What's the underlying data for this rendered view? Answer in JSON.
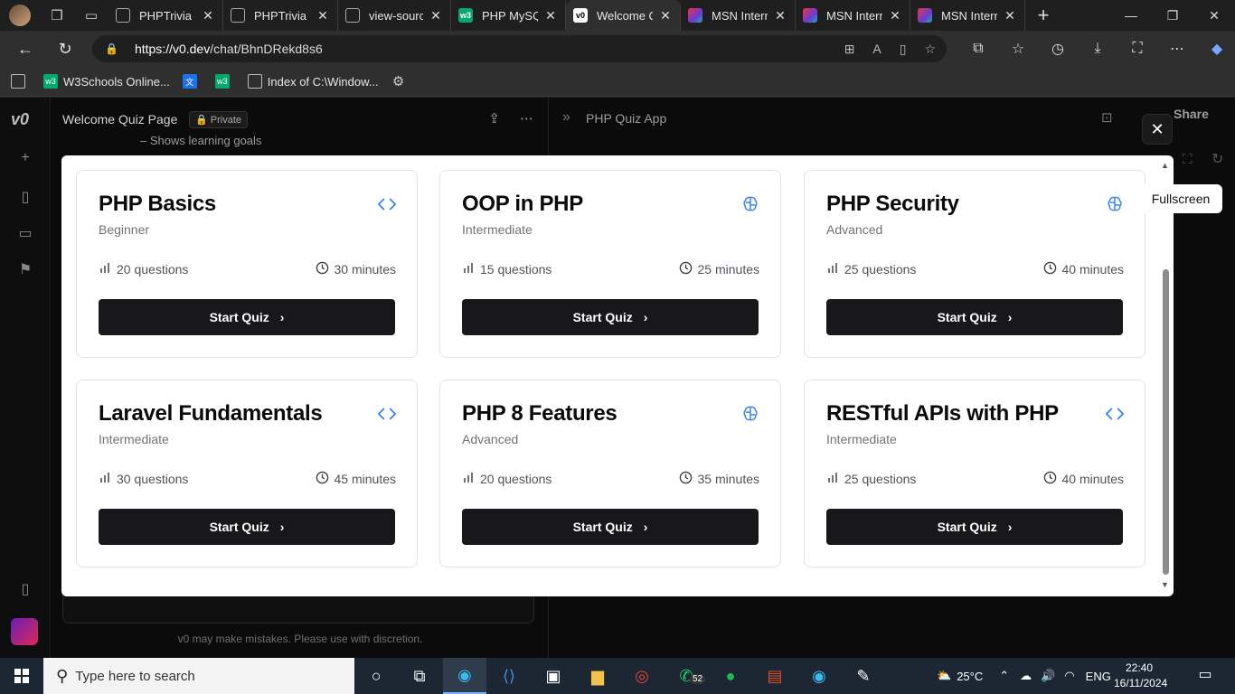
{
  "browser": {
    "tabs": [
      {
        "title": "PHPTrivia - D",
        "icon": "document-icon",
        "color": "#444444",
        "active": false
      },
      {
        "title": "PHPTrivia - D",
        "icon": "document-icon",
        "color": "#444444",
        "active": false
      },
      {
        "title": "view-source:",
        "icon": "document-icon",
        "color": "#444444",
        "active": false
      },
      {
        "title": "PHP MySQL",
        "icon": "w3schools-icon",
        "color": "#04aa6d",
        "active": false
      },
      {
        "title": "Welcome Qu",
        "icon": "v0-icon",
        "color": "#000000",
        "active": true
      },
      {
        "title": "MSN Interna",
        "icon": "msn-icon",
        "color": "#6a3bd6",
        "active": false
      },
      {
        "title": "MSN Interna",
        "icon": "msn-icon",
        "color": "#6a3bd6",
        "active": false
      },
      {
        "title": "MSN Interna",
        "icon": "msn-icon",
        "color": "#6a3bd6",
        "active": false
      }
    ],
    "address": {
      "url_host": "https://v0.dev",
      "url_path": "/chat/BhnDRekd8s6"
    },
    "bookmarks": [
      {
        "label": "",
        "icon": "page-icon"
      },
      {
        "label": "W3Schools Online...",
        "icon": "w3schools-icon"
      },
      {
        "label": "",
        "icon": "translate-icon"
      },
      {
        "label": "",
        "icon": "w3schools-icon"
      },
      {
        "label": "Index of C:\\Window...",
        "icon": "page-icon"
      },
      {
        "label": "",
        "icon": "gear-icon"
      }
    ]
  },
  "v0": {
    "chat_title": "Welcome Quiz Page",
    "private_label": "Private",
    "chat_snippet": "Shows learning goals",
    "disclaimer": "v0 may make mistakes. Please use with discretion.",
    "preview_title": "PHP Quiz App",
    "share_label": "Share",
    "tooltip": "Fullscreen",
    "close_symbol": "✕"
  },
  "quizzes": [
    {
      "title": "PHP Basics",
      "level": "Beginner",
      "questions": "20 questions",
      "duration": "30 minutes",
      "button": "Start Quiz",
      "icon": "code-icon"
    },
    {
      "title": "OOP in PHP",
      "level": "Intermediate",
      "questions": "15 questions",
      "duration": "25 minutes",
      "button": "Start Quiz",
      "icon": "brain-icon"
    },
    {
      "title": "PHP Security",
      "level": "Advanced",
      "questions": "25 questions",
      "duration": "40 minutes",
      "button": "Start Quiz",
      "icon": "brain-icon"
    },
    {
      "title": "Laravel Fundamentals",
      "level": "Intermediate",
      "questions": "30 questions",
      "duration": "45 minutes",
      "button": "Start Quiz",
      "icon": "code-icon"
    },
    {
      "title": "PHP 8 Features",
      "level": "Advanced",
      "questions": "20 questions",
      "duration": "35 minutes",
      "button": "Start Quiz",
      "icon": "brain-icon"
    },
    {
      "title": "RESTful APIs with PHP",
      "level": "Intermediate",
      "questions": "25 questions",
      "duration": "40 minutes",
      "button": "Start Quiz",
      "icon": "code-icon"
    }
  ],
  "taskbar": {
    "search_placeholder": "Type here to search",
    "whatsapp_badge": "52",
    "weather": "25°C",
    "language": "ENG",
    "time": "22:40",
    "date": "16/11/2024"
  },
  "colors": {
    "accent_blue": "#3b82f6",
    "button_dark": "#18181b"
  }
}
